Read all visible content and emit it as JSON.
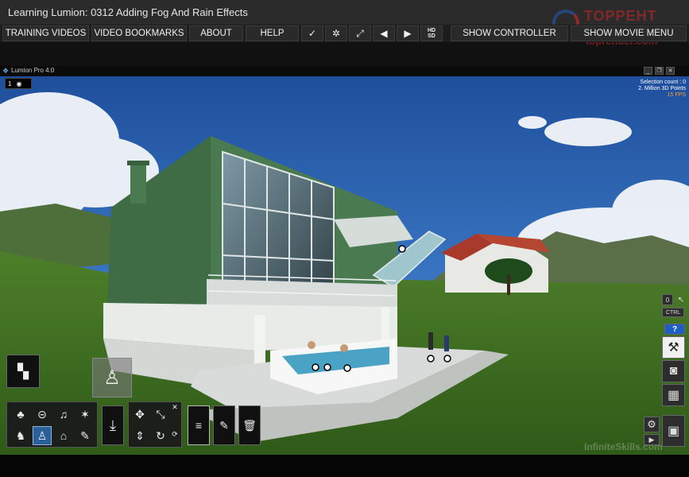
{
  "window": {
    "title": "Learning Lumion: 0312 Adding Fog And Rain Effects",
    "watermark_line1": "ТОРРЕНТ",
    "watermark_line2": "toprender.com"
  },
  "menu": {
    "training_videos": "TRAINING VIDEOS",
    "video_bookmarks": "VIDEO BOOKMARKS",
    "about": "ABOUT",
    "help": "HELP",
    "check_icon": "✓",
    "settings_icon": "✲",
    "fullscreen_icon": "⤢",
    "prev_icon": "◀",
    "next_icon": "▶",
    "hd_top": "HD",
    "hd_bottom": "SD",
    "show_controller": "SHOW CONTROLLER",
    "show_movie_menu": "SHOW MOVIE MENU"
  },
  "app": {
    "name": "Lumion Pro 4.0",
    "camera_number": "1",
    "selection_count": "Selection count : 0",
    "points": "2. Million 3D Points",
    "fps": "15 FPS"
  },
  "toolbar": {
    "ctrl_label": "CTRL",
    "help_label": "?",
    "infinite_skills": "InfiniteSkills.com"
  },
  "colors": {
    "sky_top": "#1e4f9c",
    "sky_bottom": "#6fa3d6",
    "grass": "#3f6f22",
    "building_green": "#4a7a4f",
    "selected_tool": "#2a5f9a"
  }
}
